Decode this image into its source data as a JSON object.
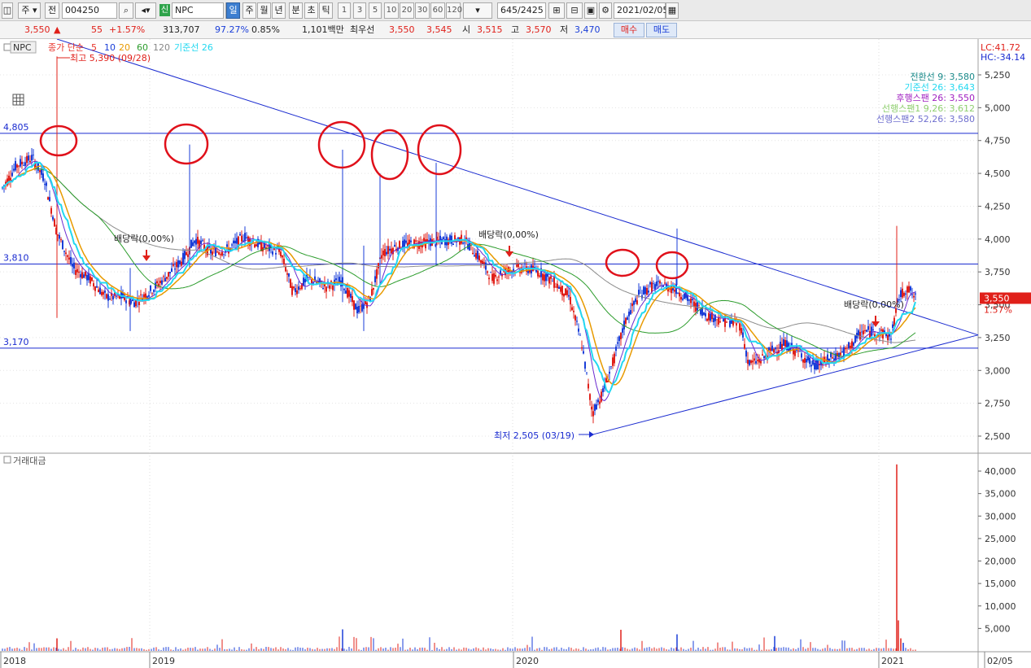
{
  "toolbar": {
    "market": "주",
    "jeon": "전",
    "code": "004250",
    "badge": "신",
    "name": "NPC",
    "periods": [
      "일",
      "주",
      "월",
      "년",
      "분",
      "초",
      "틱"
    ],
    "minutes": [
      "1",
      "3",
      "5",
      "10",
      "20",
      "30",
      "60",
      "120"
    ],
    "count": "645/2425",
    "date": "2021/02/05"
  },
  "quote": {
    "price": "3,550",
    "arrow": "▲",
    "change": "55",
    "change_pct": "+1.57%",
    "volume": "313,707",
    "vol_ratio": "97.27%",
    "turnover": "0.85%",
    "amount": "1,101백만",
    "best_label": "최우선",
    "best_ask": "3,550",
    "best_bid": "3,545",
    "open_label": "시",
    "open": "3,515",
    "high_label": "고",
    "high": "3,570",
    "low_label": "저",
    "low": "3,470",
    "buy_button": "매수",
    "sell_button": "매도"
  },
  "price_panel": {
    "legend": {
      "name": "NPC",
      "ma_label": "종가 단순",
      "ma_periods": [
        "5",
        "10",
        "20",
        "60",
        "120"
      ],
      "ma_colors": [
        "#e8352c",
        "#1a3ed8",
        "#e89a00",
        "#2c9c2c",
        "#888888"
      ],
      "kijun": "기준선 26"
    },
    "lc": "LC:41.72",
    "hc": "HC:-34.14",
    "ichimoku": [
      {
        "text": "전환선 9: 3,580",
        "color": "#1a8a8a"
      },
      {
        "text": "기준선 26: 3,643",
        "color": "#22d8f0"
      },
      {
        "text": "후행스팬 26: 3,550",
        "color": "#a020c0"
      },
      {
        "text": "선행스팬1 9,26: 3,612",
        "color": "#8fcf6f"
      },
      {
        "text": "선행스팬2 52,26: 3,580",
        "color": "#6f6fcf"
      }
    ],
    "hlines": [
      {
        "label": "4,805",
        "value": 4805
      },
      {
        "label": "3,810",
        "value": 3810
      },
      {
        "label": "3,170",
        "value": 3170
      }
    ],
    "high_annotation": "최고 5,390 (09/28)",
    "low_annotation": "최저 2,505 (03/19)",
    "dividend_label": "배당락(0,00%)",
    "current_price_tag": "3,550",
    "current_pct_tag": "1.57%",
    "y_ticks": [
      "5,250",
      "5,000",
      "4,750",
      "4,500",
      "4,250",
      "4,000",
      "3,750",
      "3,500",
      "3,250",
      "3,000",
      "2,750",
      "2,500"
    ]
  },
  "volume_panel": {
    "title": "거래대금",
    "y_ticks": [
      "40,000",
      "35,000",
      "30,000",
      "25,000",
      "20,000",
      "15,000",
      "10,000",
      "5,000"
    ]
  },
  "x_axis": {
    "labels": [
      "2018",
      "2019",
      "2020",
      "2021",
      "02/05"
    ]
  },
  "colors": {
    "up": "#e0201a",
    "down": "#1a3ed8",
    "kijun": "#22d8f0",
    "circle": "#e0101a"
  }
}
